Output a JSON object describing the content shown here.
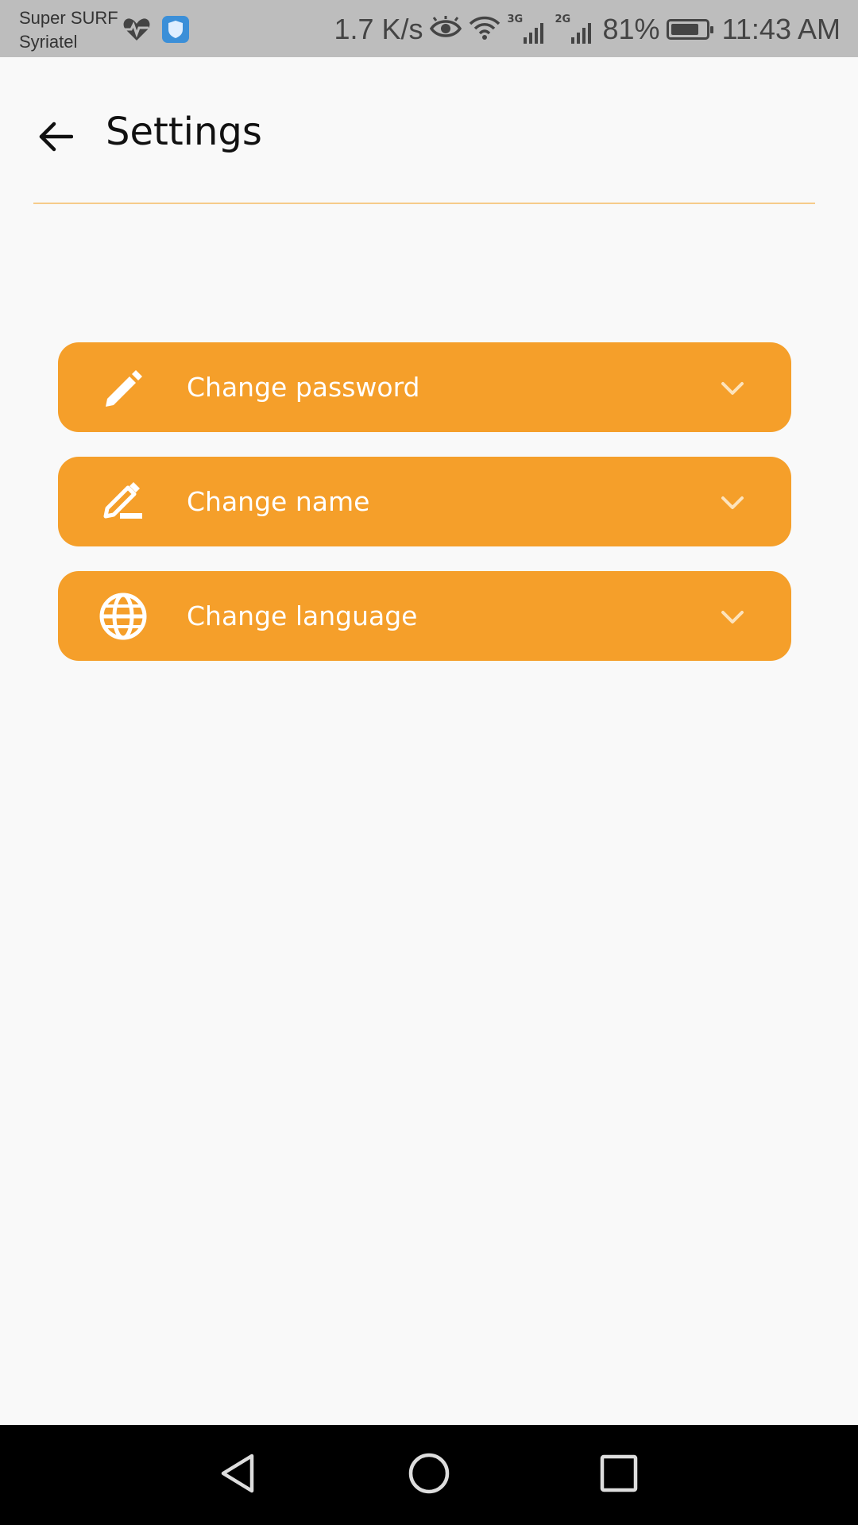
{
  "status_bar": {
    "carrier_line1": "Super SURF",
    "carrier_line2": "Syriatel",
    "speed": "1.7 K/s",
    "sim1_tag": "3G",
    "sim2_tag": "2G",
    "battery_percent": "81%",
    "battery_level": 0.81,
    "time": "11:43 AM",
    "icons": [
      "heart-pulse-icon",
      "shield-app-icon",
      "eye-icon",
      "wifi-icon",
      "signal-icon",
      "signal-icon",
      "battery-icon"
    ]
  },
  "header": {
    "title": "Settings",
    "back_icon": "arrow-left-icon"
  },
  "menu": {
    "items": [
      {
        "label": "Change password",
        "icon": "pencil-icon"
      },
      {
        "label": "Change name",
        "icon": "edit-underline-icon"
      },
      {
        "label": "Change language",
        "icon": "globe-icon"
      }
    ]
  },
  "nav_bar": {
    "buttons": [
      "back-triangle-icon",
      "home-circle-icon",
      "recents-square-icon"
    ]
  },
  "colors": {
    "accent": "#f59f2a",
    "divider": "#f6cc8a",
    "background": "#f9f9f9",
    "status_bar": "#bdbdbd"
  }
}
